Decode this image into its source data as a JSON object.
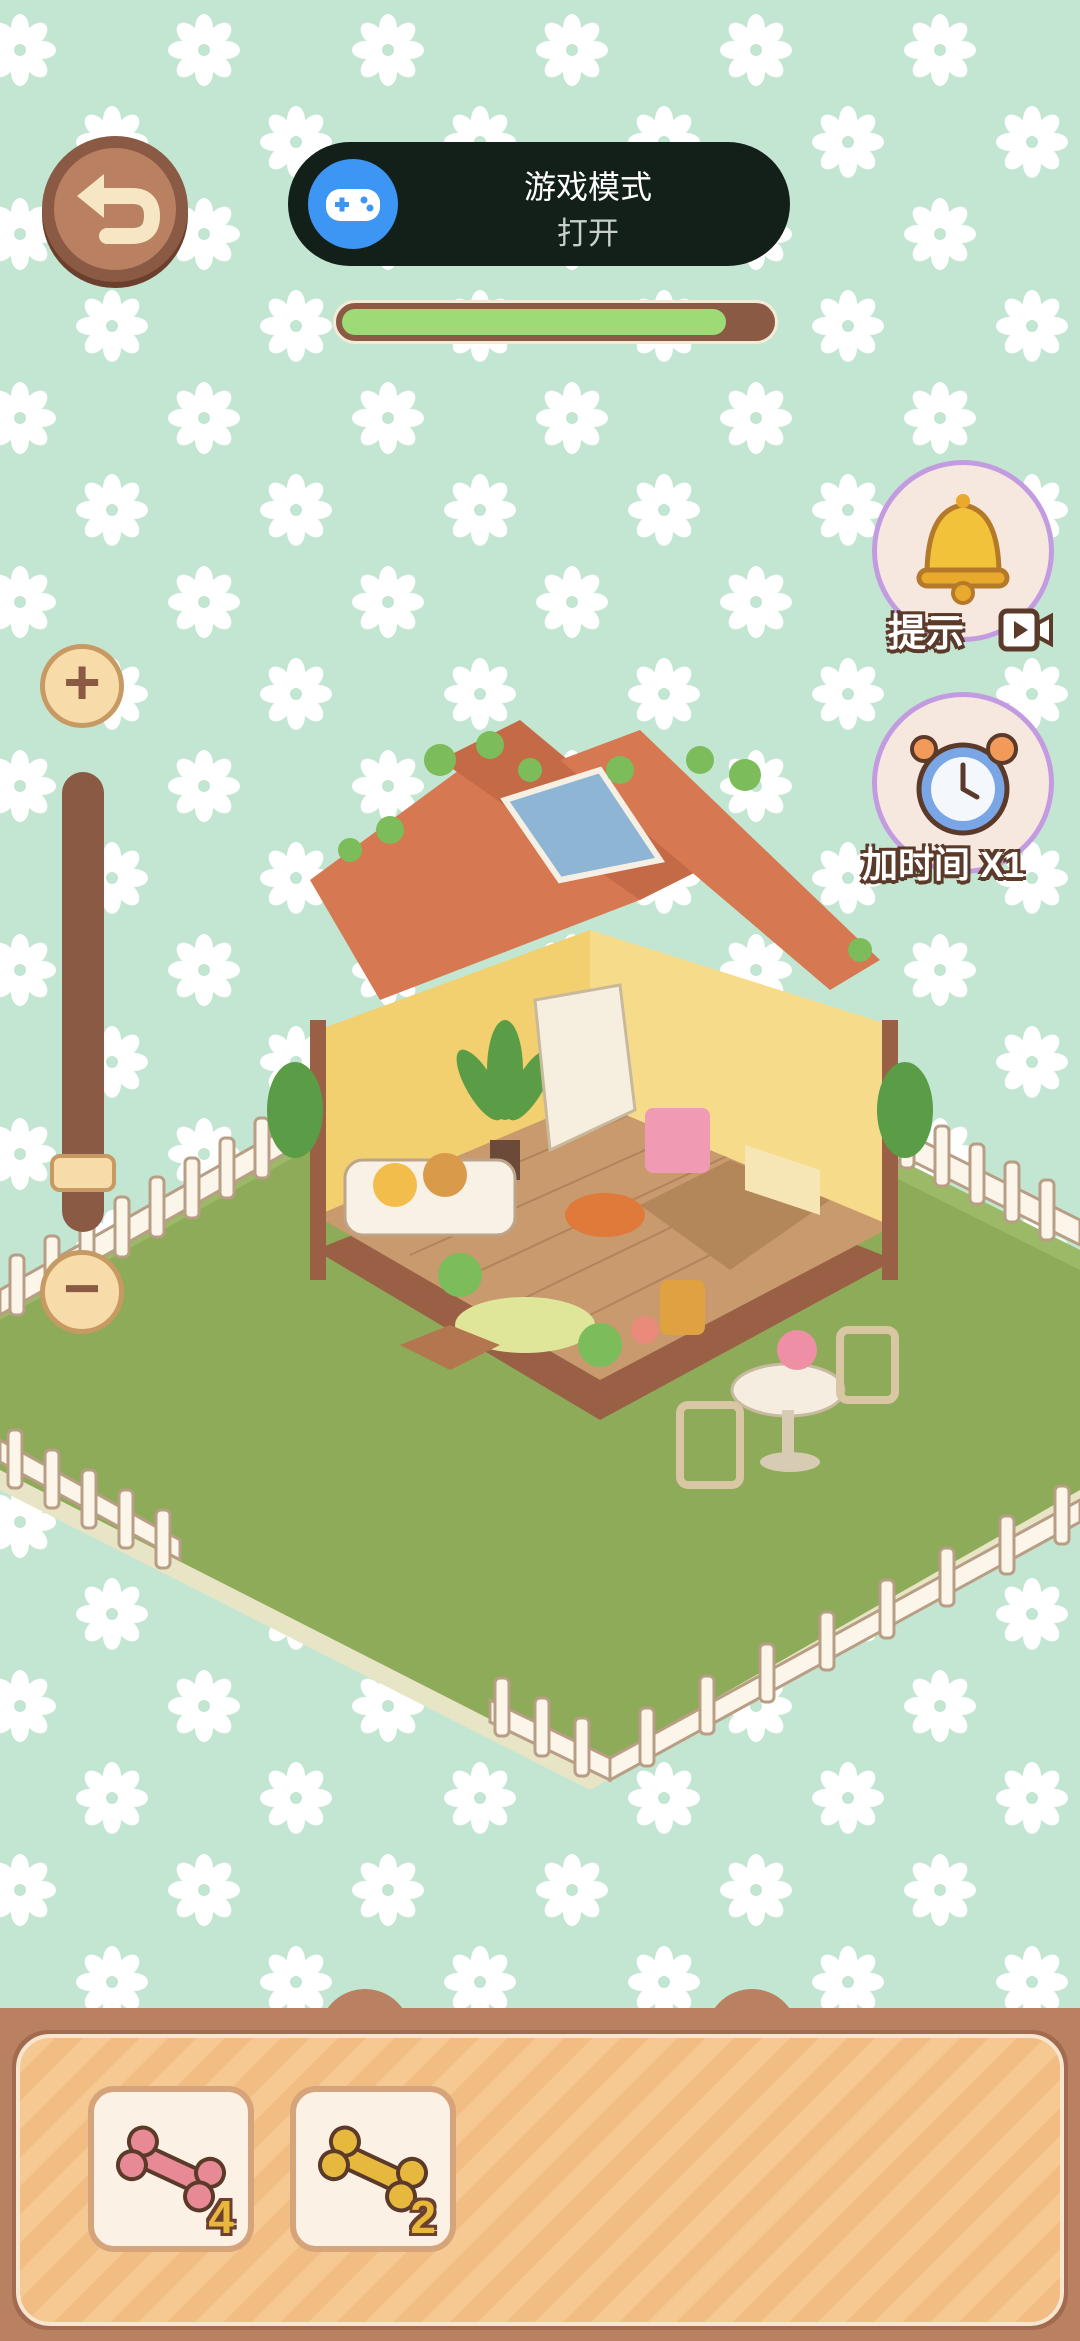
{
  "toast": {
    "title": "游戏模式",
    "subtitle": "打开",
    "icon": "gamepad-icon"
  },
  "level_progress": 0.9,
  "buttons": {
    "back_icon": "back-arrow-icon",
    "hint": {
      "label": "提示",
      "icon": "bell-icon",
      "badge_icon": "video-ad-icon"
    },
    "add_time": {
      "label": "加时间 X1",
      "icon": "stopwatch-icon"
    },
    "zoom_in_icon": "plus-icon",
    "zoom_out_icon": "minus-icon"
  },
  "zoom_level": 0.08,
  "inventory": [
    {
      "name": "pink-bone",
      "color": "#e88a96",
      "count": "4"
    },
    {
      "name": "gold-bone",
      "color": "#e6b93e",
      "count": "2"
    }
  ],
  "colors": {
    "background": "#c3e6d3",
    "grass": "#8dab59",
    "roof": "#d67851",
    "wall": "#f2cf6f",
    "tray": "#f6c892",
    "brown": "#8a5a44"
  }
}
